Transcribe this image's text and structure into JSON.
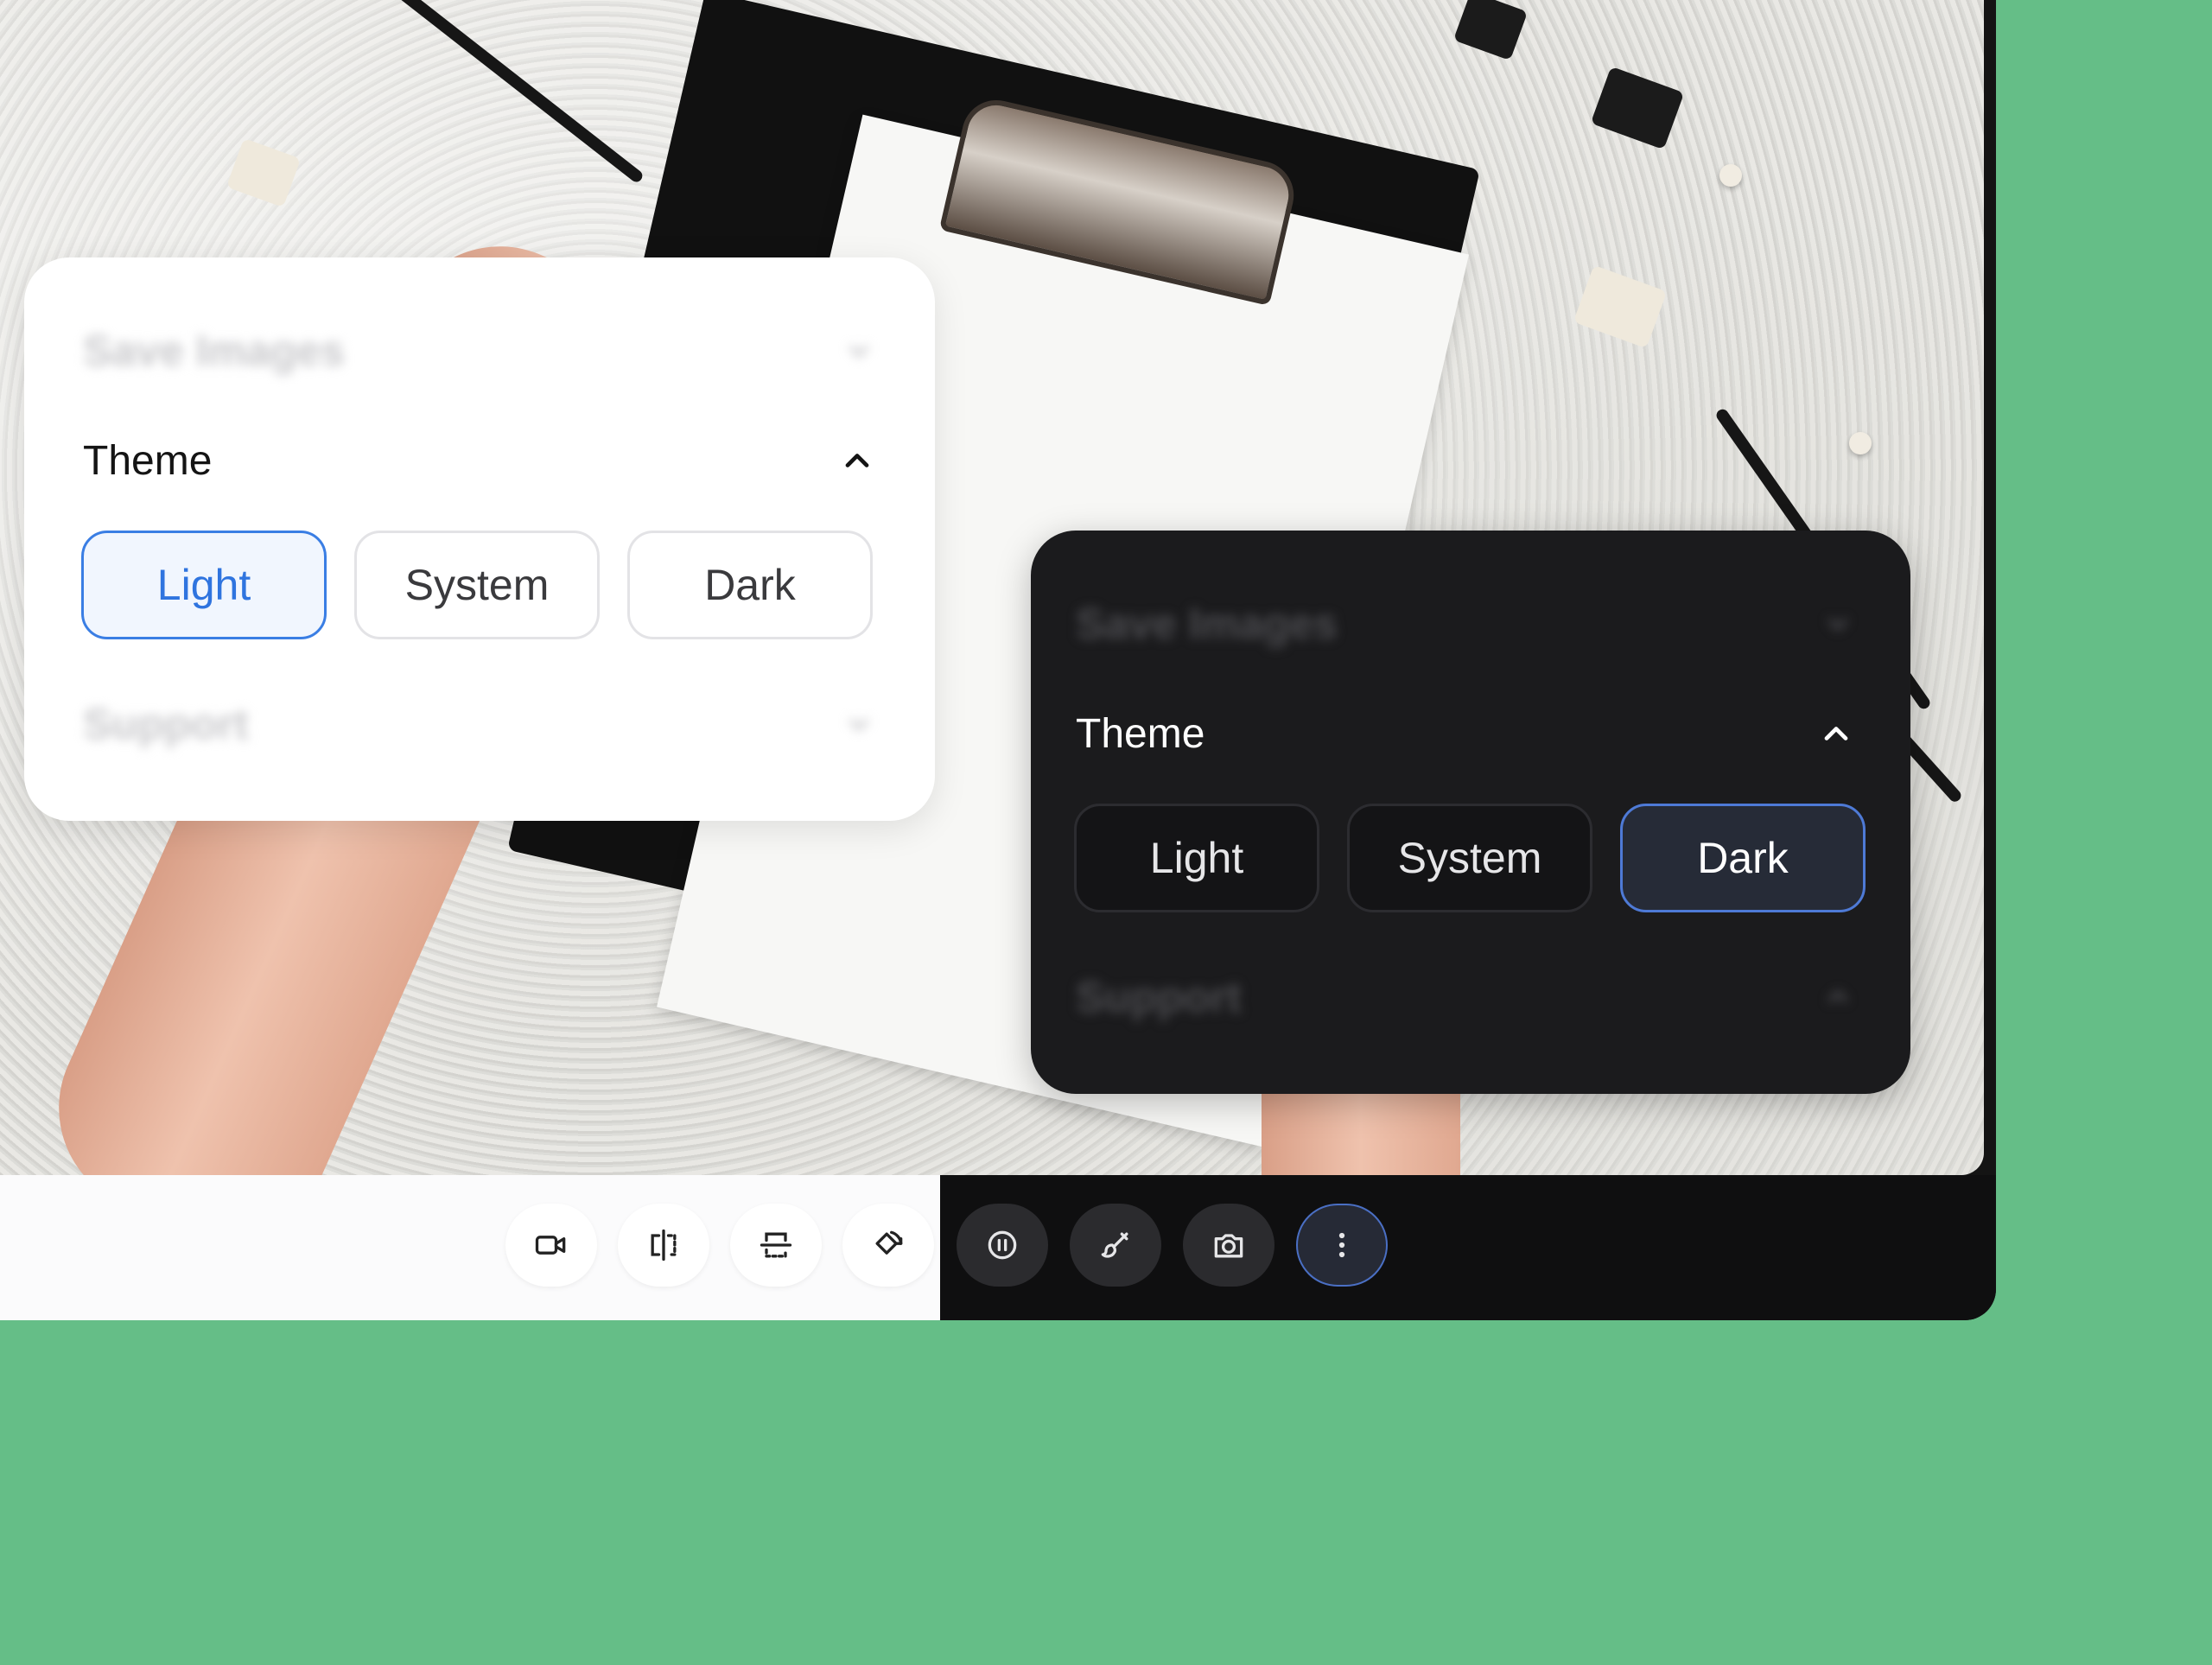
{
  "light_panel": {
    "save_images_label": "Save Images",
    "theme_label": "Theme",
    "options": [
      "Light",
      "System",
      "Dark"
    ],
    "selected": "Light",
    "support_label": "Support"
  },
  "dark_panel": {
    "save_images_label": "Save Images",
    "theme_label": "Theme",
    "options": [
      "Light",
      "System",
      "Dark"
    ],
    "selected": "Dark",
    "support_label": "Support"
  },
  "toolbar": {
    "light_controls": [
      "video-camera-icon",
      "flip-horizontal-icon",
      "flip-vertical-icon",
      "rotate-icon"
    ],
    "dark_controls": [
      "pause-icon",
      "brush-icon",
      "camera-icon",
      "more-vertical-icon"
    ],
    "active_control": "more-vertical-icon"
  },
  "colors": {
    "background": "#65be87",
    "accent_blue": "#3a7ee4",
    "dark_panel": "#1b1b1d",
    "light_panel": "#ffffff"
  }
}
